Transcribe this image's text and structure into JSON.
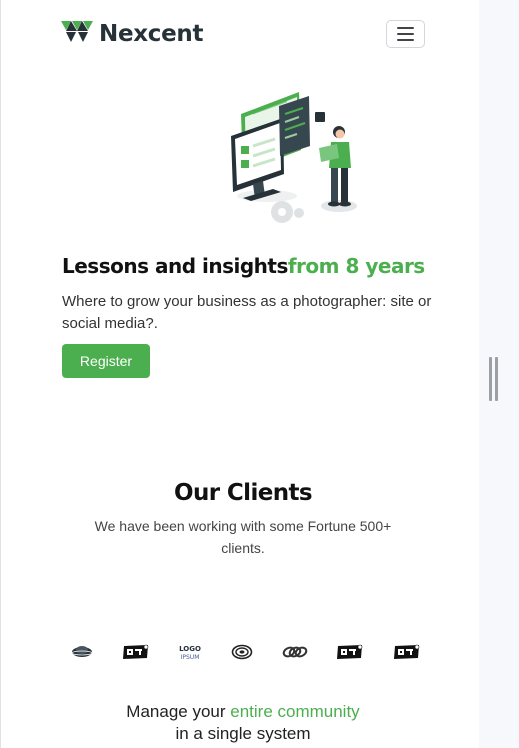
{
  "brand": {
    "name": "Nexcent",
    "icon": "nexcent-logo-icon",
    "color": "#4caf4f"
  },
  "nav": {
    "menu_icon": "hamburger-menu-icon"
  },
  "hero": {
    "title_main": "Lessons and insights",
    "title_accent": "from 8 years",
    "subtitle": "Where to grow your business as a photographer: site or social media?.",
    "register_label": "Register",
    "illustration": "developer-illustration"
  },
  "clients": {
    "title": "Our Clients",
    "subtitle": "We have been working with some Fortune 500+ clients.",
    "logos": [
      "client-logo-1-icon",
      "client-logo-2-icon",
      "client-logo-3-icon",
      "client-logo-4-icon",
      "client-logo-5-icon",
      "client-logo-6-icon",
      "client-logo-7-icon"
    ]
  },
  "community": {
    "title_start": "Manage your ",
    "title_accent": "entire community",
    "title_end": "in a single system"
  },
  "colors": {
    "accent": "#4caf4f",
    "text": "#263238"
  }
}
